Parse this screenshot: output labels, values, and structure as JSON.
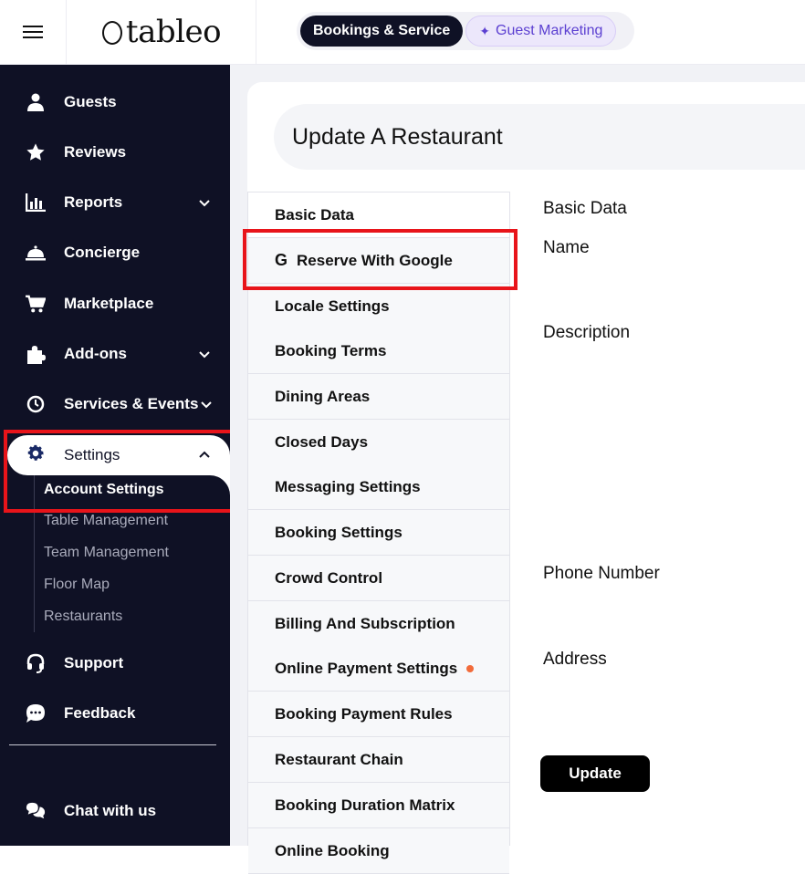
{
  "app": {
    "logo_text": "tableo"
  },
  "modes": [
    {
      "label": "Bookings & Service"
    },
    {
      "label": "Guest Marketing"
    }
  ],
  "sidebar": {
    "items": [
      {
        "label": "Guests",
        "icon": "user-icon"
      },
      {
        "label": "Reviews",
        "icon": "star-icon"
      },
      {
        "label": "Reports",
        "icon": "bar-chart-icon"
      },
      {
        "label": "Concierge",
        "icon": "service-bell-icon"
      },
      {
        "label": "Marketplace",
        "icon": "cart-icon"
      },
      {
        "label": "Add-ons",
        "icon": "puzzle-icon"
      },
      {
        "label": "Services & Events",
        "icon": "clock-icon"
      },
      {
        "label": "Settings",
        "icon": "gear-icon"
      },
      {
        "label": "Support",
        "icon": "headset-icon"
      },
      {
        "label": "Feedback",
        "icon": "chat-bubble-icon"
      },
      {
        "label": "Chat with us",
        "icon": "chat-bubbles-icon"
      }
    ],
    "settings_sub": [
      {
        "label": "Account Settings"
      },
      {
        "label": "Table Management"
      },
      {
        "label": "Team Management"
      },
      {
        "label": "Floor Map"
      },
      {
        "label": "Restaurants"
      }
    ]
  },
  "page": {
    "title": "Update A Restaurant"
  },
  "settings_menu": [
    {
      "label": "Basic Data"
    },
    {
      "label": "Reserve With Google",
      "icon_glyph": "G"
    },
    {
      "label": "Locale Settings"
    },
    {
      "label": "Booking Terms"
    },
    {
      "label": "Dining Areas"
    },
    {
      "label": "Closed Days"
    },
    {
      "label": "Messaging Settings"
    },
    {
      "label": "Booking Settings"
    },
    {
      "label": "Crowd Control"
    },
    {
      "label": "Billing And Subscription"
    },
    {
      "label": "Online Payment Settings"
    },
    {
      "label": "Booking Payment Rules"
    },
    {
      "label": "Restaurant Chain"
    },
    {
      "label": "Booking Duration Matrix"
    },
    {
      "label": "Online Booking"
    }
  ],
  "form": {
    "section_title": "Basic Data",
    "name_label": "Name",
    "description_label": "Description",
    "phone_label": "Phone Number",
    "address_label": "Address",
    "update_label": "Update"
  },
  "colors": {
    "sidebar_bg": "#0f1125",
    "accent_purple": "#5b3fd1",
    "highlight_red": "#e8141a",
    "notice_dot": "#f26b3a"
  }
}
